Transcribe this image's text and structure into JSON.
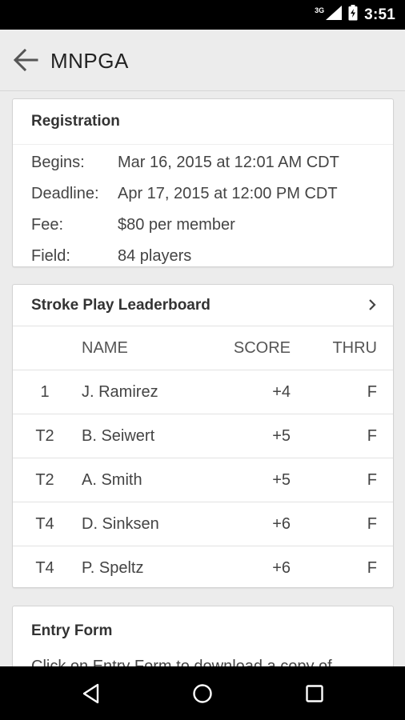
{
  "status_bar": {
    "time": "3:51",
    "network": "3G"
  },
  "app_bar": {
    "title": "MNPGA"
  },
  "registration": {
    "title": "Registration",
    "rows": [
      {
        "label": "Begins:",
        "value": "Mar 16, 2015 at 12:01 AM CDT"
      },
      {
        "label": "Deadline:",
        "value": "Apr 17, 2015 at 12:00 PM CDT"
      },
      {
        "label": "Fee:",
        "value": "$80 per member"
      },
      {
        "label": "Field:",
        "value": "84 players"
      }
    ]
  },
  "leaderboard": {
    "title": "Stroke Play Leaderboard",
    "columns": {
      "name": "NAME",
      "score": "SCORE",
      "thru": "THRU"
    },
    "rows": [
      {
        "pos": "1",
        "name": "J. Ramirez",
        "score": "+4",
        "thru": "F"
      },
      {
        "pos": "T2",
        "name": "B. Seiwert",
        "score": "+5",
        "thru": "F"
      },
      {
        "pos": "T2",
        "name": "A. Smith",
        "score": "+5",
        "thru": "F"
      },
      {
        "pos": "T4",
        "name": "D. Sinksen",
        "score": "+6",
        "thru": "F"
      },
      {
        "pos": "T4",
        "name": "P. Speltz",
        "score": "+6",
        "thru": "F"
      }
    ]
  },
  "entry_form": {
    "title": "Entry Form",
    "text": "Click on Entry Form to download a copy of"
  },
  "icons": {
    "back": "arrow-back-icon",
    "chevron": "chevron-right-icon",
    "nav_back": "nav-back-icon",
    "nav_home": "nav-home-icon",
    "nav_recents": "nav-recents-icon"
  },
  "colors": {
    "background": "#ececec",
    "card": "#ffffff",
    "bars": "#000000"
  }
}
